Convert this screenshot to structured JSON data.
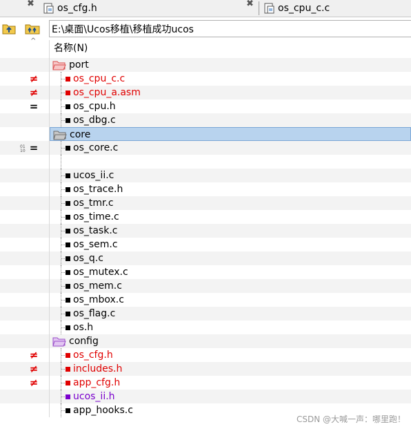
{
  "tabs": [
    {
      "label": "os_cfg.h",
      "close": "✖"
    },
    {
      "label": "os_cpu_c.c",
      "close": "✖"
    }
  ],
  "path": "E:\\桌面\\Ucos移植\\移植成功ucos",
  "column_header": "名称(N)",
  "header_caret": "^",
  "rows": [
    {
      "type": "folder",
      "name": "port",
      "icon": "folder-open-red",
      "marker": ""
    },
    {
      "type": "file",
      "name": "os_cpu_c.c",
      "color": "#e00000",
      "marker": "≠"
    },
    {
      "type": "file",
      "name": "os_cpu_a.asm",
      "color": "#e00000",
      "marker": "≠"
    },
    {
      "type": "file",
      "name": "os_cpu.h",
      "color": "#000000",
      "marker": "="
    },
    {
      "type": "file",
      "name": "os_dbg.c",
      "color": "#000000",
      "marker": ""
    },
    {
      "type": "folder",
      "name": "core",
      "icon": "folder-open-gray",
      "marker": "",
      "selected": true
    },
    {
      "type": "file",
      "name": "os_core.c",
      "color": "#000000",
      "marker": "=",
      "extra": true
    },
    {
      "type": "blank"
    },
    {
      "type": "file",
      "name": "ucos_ii.c",
      "color": "#000000",
      "marker": ""
    },
    {
      "type": "file",
      "name": "os_trace.h",
      "color": "#000000",
      "marker": ""
    },
    {
      "type": "file",
      "name": "os_tmr.c",
      "color": "#000000",
      "marker": ""
    },
    {
      "type": "file",
      "name": "os_time.c",
      "color": "#000000",
      "marker": ""
    },
    {
      "type": "file",
      "name": "os_task.c",
      "color": "#000000",
      "marker": ""
    },
    {
      "type": "file",
      "name": "os_sem.c",
      "color": "#000000",
      "marker": ""
    },
    {
      "type": "file",
      "name": "os_q.c",
      "color": "#000000",
      "marker": ""
    },
    {
      "type": "file",
      "name": "os_mutex.c",
      "color": "#000000",
      "marker": ""
    },
    {
      "type": "file",
      "name": "os_mem.c",
      "color": "#000000",
      "marker": ""
    },
    {
      "type": "file",
      "name": "os_mbox.c",
      "color": "#000000",
      "marker": ""
    },
    {
      "type": "file",
      "name": "os_flag.c",
      "color": "#000000",
      "marker": ""
    },
    {
      "type": "file",
      "name": "os.h",
      "color": "#000000",
      "marker": ""
    },
    {
      "type": "folder",
      "name": "config",
      "icon": "folder-open-purple",
      "marker": ""
    },
    {
      "type": "file",
      "name": "os_cfg.h",
      "color": "#e00000",
      "marker": "≠"
    },
    {
      "type": "file",
      "name": "includes.h",
      "color": "#e00000",
      "marker": "≠"
    },
    {
      "type": "file",
      "name": "app_cfg.h",
      "color": "#e00000",
      "marker": "≠"
    },
    {
      "type": "file",
      "name": "ucos_ii.h",
      "color": "#7a00cc",
      "marker": ""
    },
    {
      "type": "file",
      "name": "app_hooks.c",
      "color": "#000000",
      "marker": ""
    }
  ],
  "watermark": "CSDN @大喊一声：哪里跑！"
}
